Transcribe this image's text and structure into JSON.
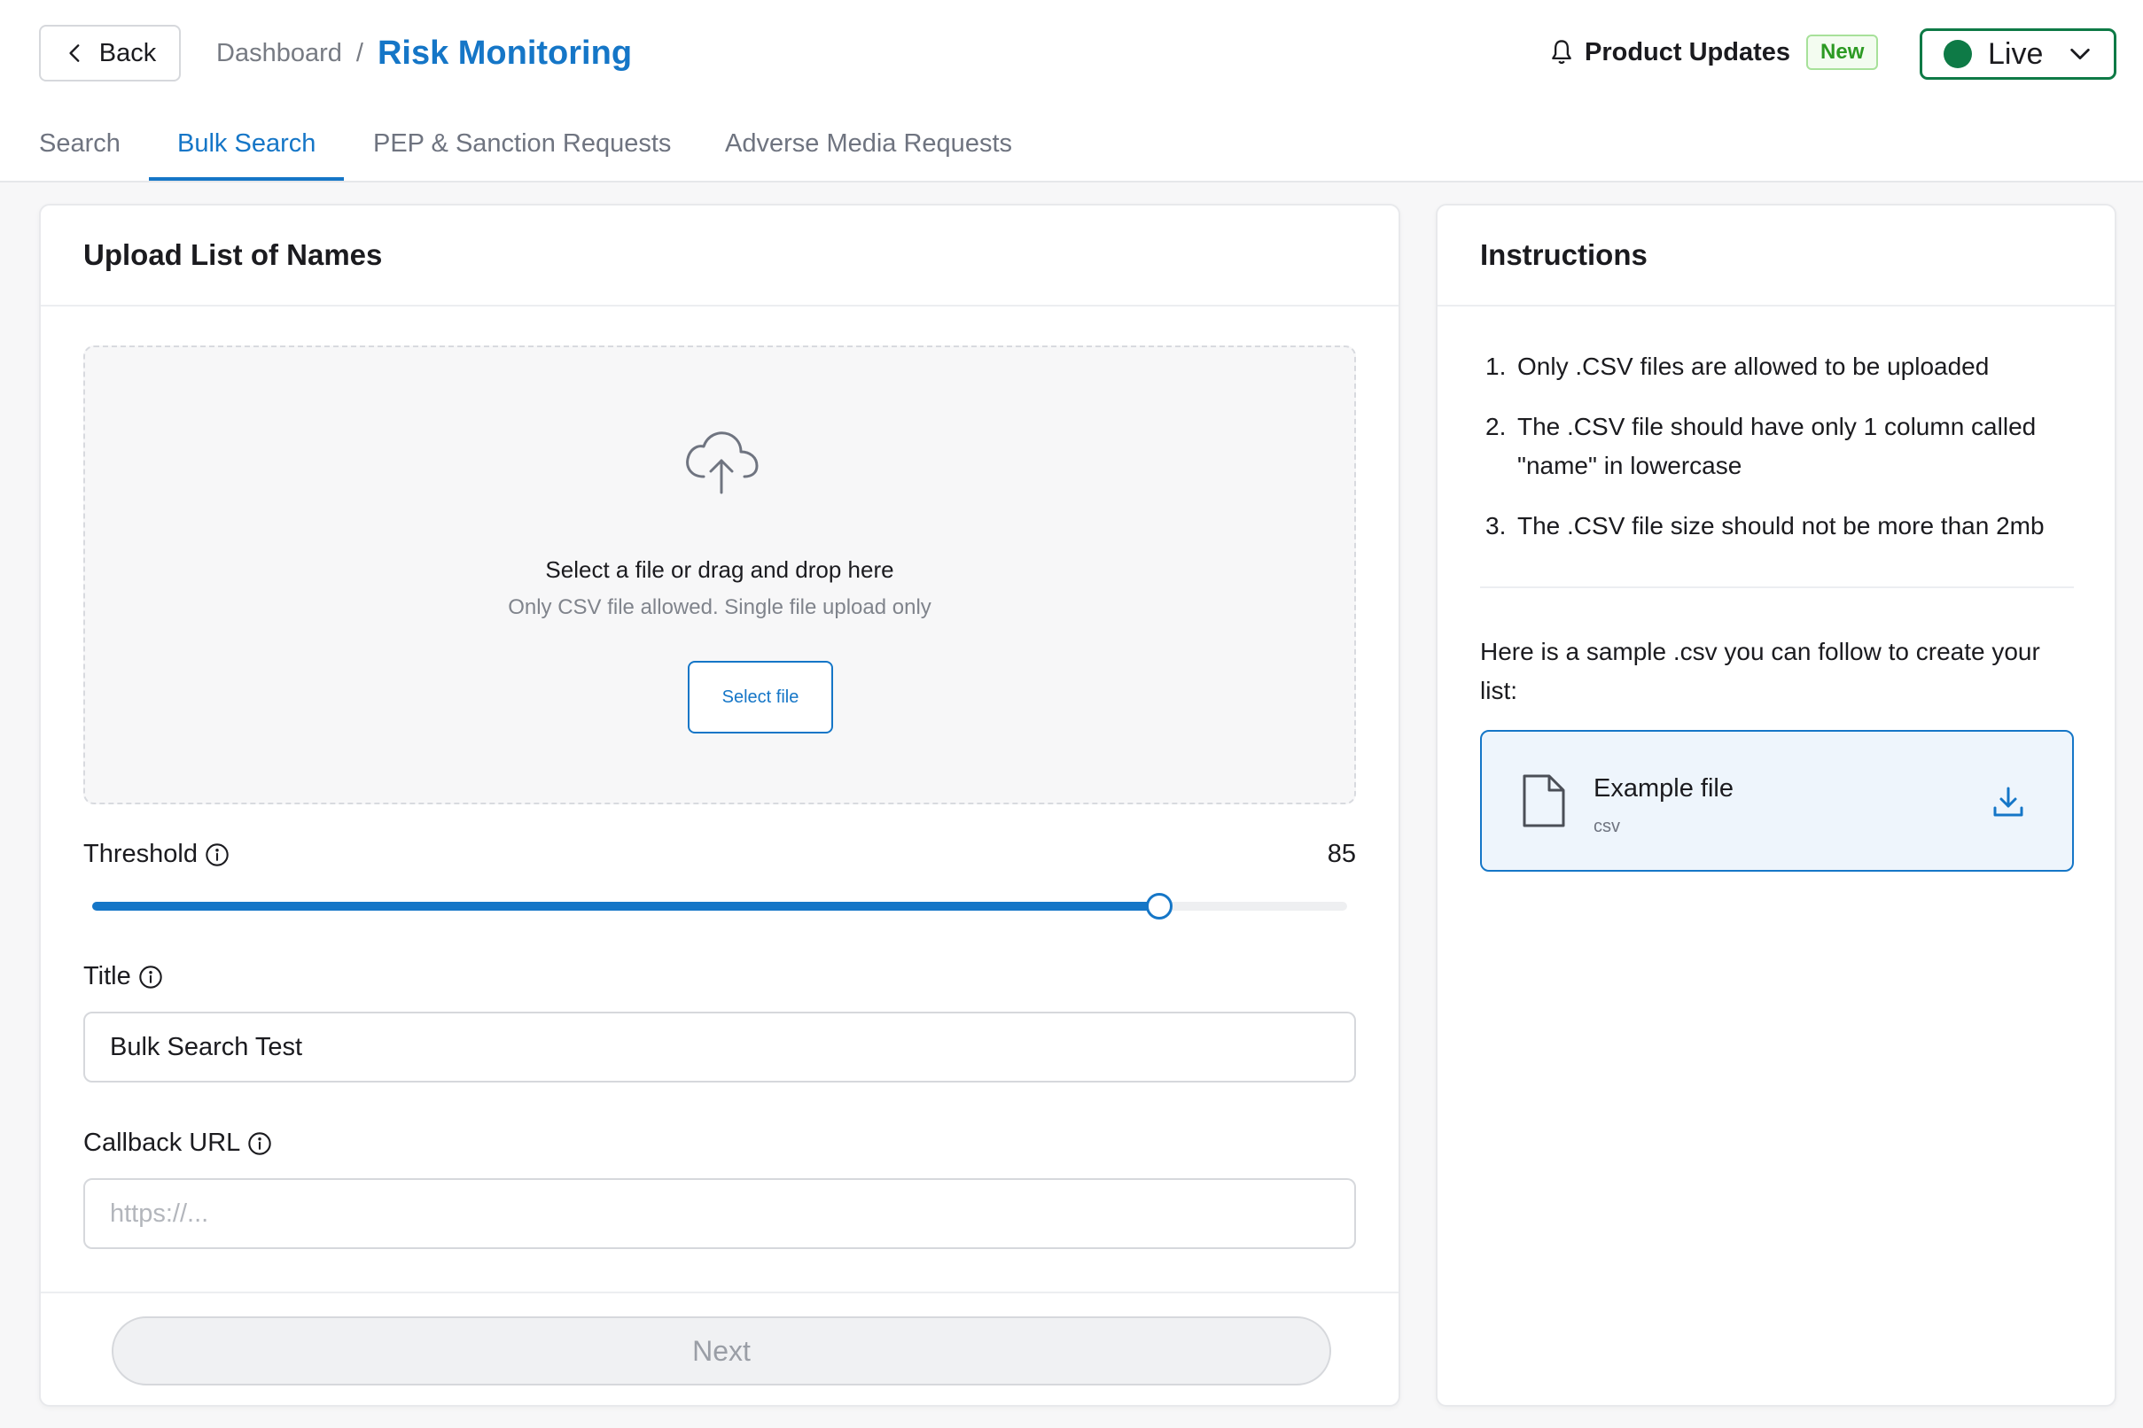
{
  "header": {
    "back_label": "Back",
    "breadcrumb": {
      "parent": "Dashboard",
      "separator": "/",
      "current": "Risk Monitoring"
    },
    "product_updates": {
      "label": "Product Updates",
      "badge": "New"
    },
    "environment": {
      "selected": "Live"
    }
  },
  "tabs": [
    {
      "label": "Search",
      "active": false
    },
    {
      "label": "Bulk Search",
      "active": true
    },
    {
      "label": "PEP & Sanction Requests",
      "active": false
    },
    {
      "label": "Adverse Media Requests",
      "active": false
    }
  ],
  "upload_card": {
    "title": "Upload List of Names",
    "dropzone": {
      "title": "Select a file or drag and drop here",
      "subtitle": "Only CSV file allowed. Single file upload only",
      "button_label": "Select file"
    },
    "threshold": {
      "label": "Threshold",
      "value": "85",
      "percent": 85
    },
    "title_field": {
      "label": "Title",
      "value": "Bulk Search Test"
    },
    "callback_field": {
      "label": "Callback URL",
      "placeholder": "https://..."
    },
    "next_label": "Next"
  },
  "instructions_card": {
    "title": "Instructions",
    "items": [
      {
        "num": "1.",
        "text": "Only .CSV files are allowed to be uploaded"
      },
      {
        "num": "2.",
        "text": "The .CSV file should have only 1 column called \"name\" in lowercase"
      },
      {
        "num": "3.",
        "text": "The .CSV file size should not be more than 2mb"
      }
    ],
    "sample_text": "Here is a sample .csv you can follow to create your list:",
    "example_file": {
      "name": "Example file",
      "ext": "csv"
    }
  },
  "colors": {
    "accent": "#1576c7",
    "live_green": "#0e7a46",
    "new_badge": "#2c9a23"
  }
}
